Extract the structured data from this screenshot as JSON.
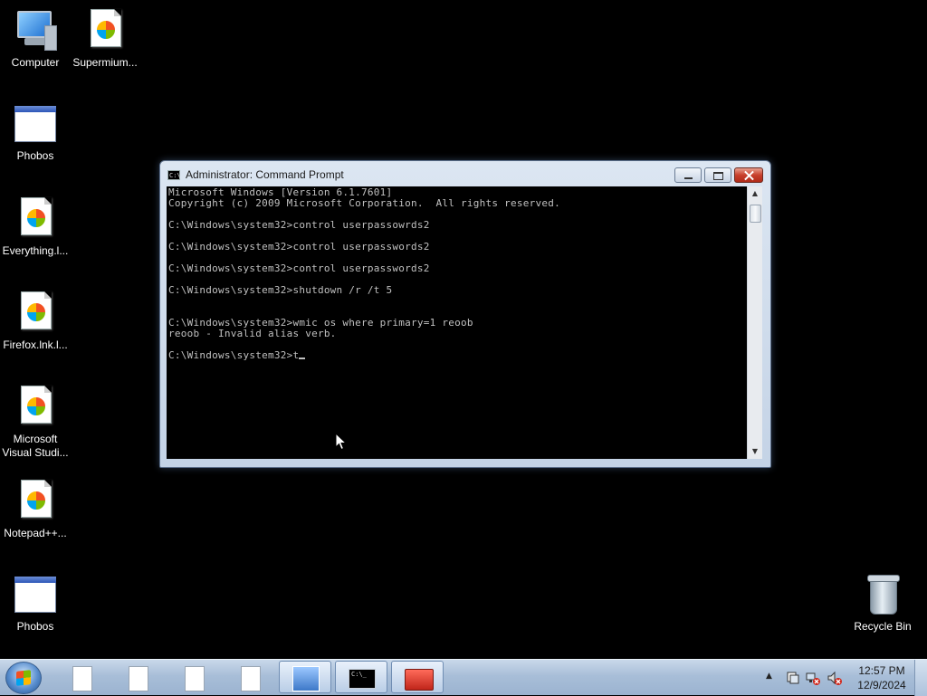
{
  "desktop": {
    "icons": [
      {
        "label": "Computer",
        "icon": "computer-icon"
      },
      {
        "label": "Supermium...",
        "icon": "shortcut-file-icon"
      },
      {
        "label": "Phobos",
        "icon": "app-window-icon"
      },
      {
        "label": "Everything.l...",
        "icon": "shortcut-file-icon"
      },
      {
        "label": "Firefox.lnk.l...",
        "icon": "shortcut-file-icon"
      },
      {
        "label": "Microsoft Visual Studi...",
        "icon": "shortcut-file-icon"
      },
      {
        "label": "Notepad++...",
        "icon": "shortcut-file-icon"
      },
      {
        "label": "Phobos",
        "icon": "app-window-icon"
      },
      {
        "label": "Recycle Bin",
        "icon": "recycle-bin-icon"
      }
    ]
  },
  "cmd_window": {
    "title": "Administrator: Command Prompt",
    "system_icon_text": "C:\\",
    "lines": [
      "Microsoft Windows [Version 6.1.7601]",
      "Copyright (c) 2009 Microsoft Corporation.  All rights reserved.",
      "",
      "C:\\Windows\\system32>control userpassowrds2",
      "",
      "C:\\Windows\\system32>control userpasswords2",
      "",
      "C:\\Windows\\system32>control userpasswords2",
      "",
      "C:\\Windows\\system32>shutdown /r /t 5",
      "",
      "",
      "C:\\Windows\\system32>wmic os where primary=1 reoob",
      "reoob - Invalid alias verb.",
      "",
      "C:\\Windows\\system32>t"
    ],
    "scrollbar": {
      "up_arrow": "▲",
      "down_arrow": "▼"
    }
  },
  "taskbar": {
    "items": [
      {
        "icon": "document-icon",
        "active": false
      },
      {
        "icon": "document-icon",
        "active": false
      },
      {
        "icon": "document-icon",
        "active": false
      },
      {
        "icon": "document-icon",
        "active": false
      },
      {
        "icon": "network-app-icon",
        "active": true
      },
      {
        "icon": "command-prompt-icon",
        "active": true,
        "glyph": "C:\\_"
      },
      {
        "icon": "toolbox-icon",
        "active": true
      }
    ],
    "tray": {
      "expand_glyph": "▲",
      "icons": [
        "action-center-icon",
        "network-disconnected-icon",
        "volume-muted-icon"
      ],
      "time": "12:57 PM",
      "date": "12/9/2024"
    }
  },
  "colors": {
    "desktop_background": "#000000",
    "console_text": "#c0c0c0",
    "close_button": "#c8402c",
    "taskbar": "#a8bed8"
  }
}
